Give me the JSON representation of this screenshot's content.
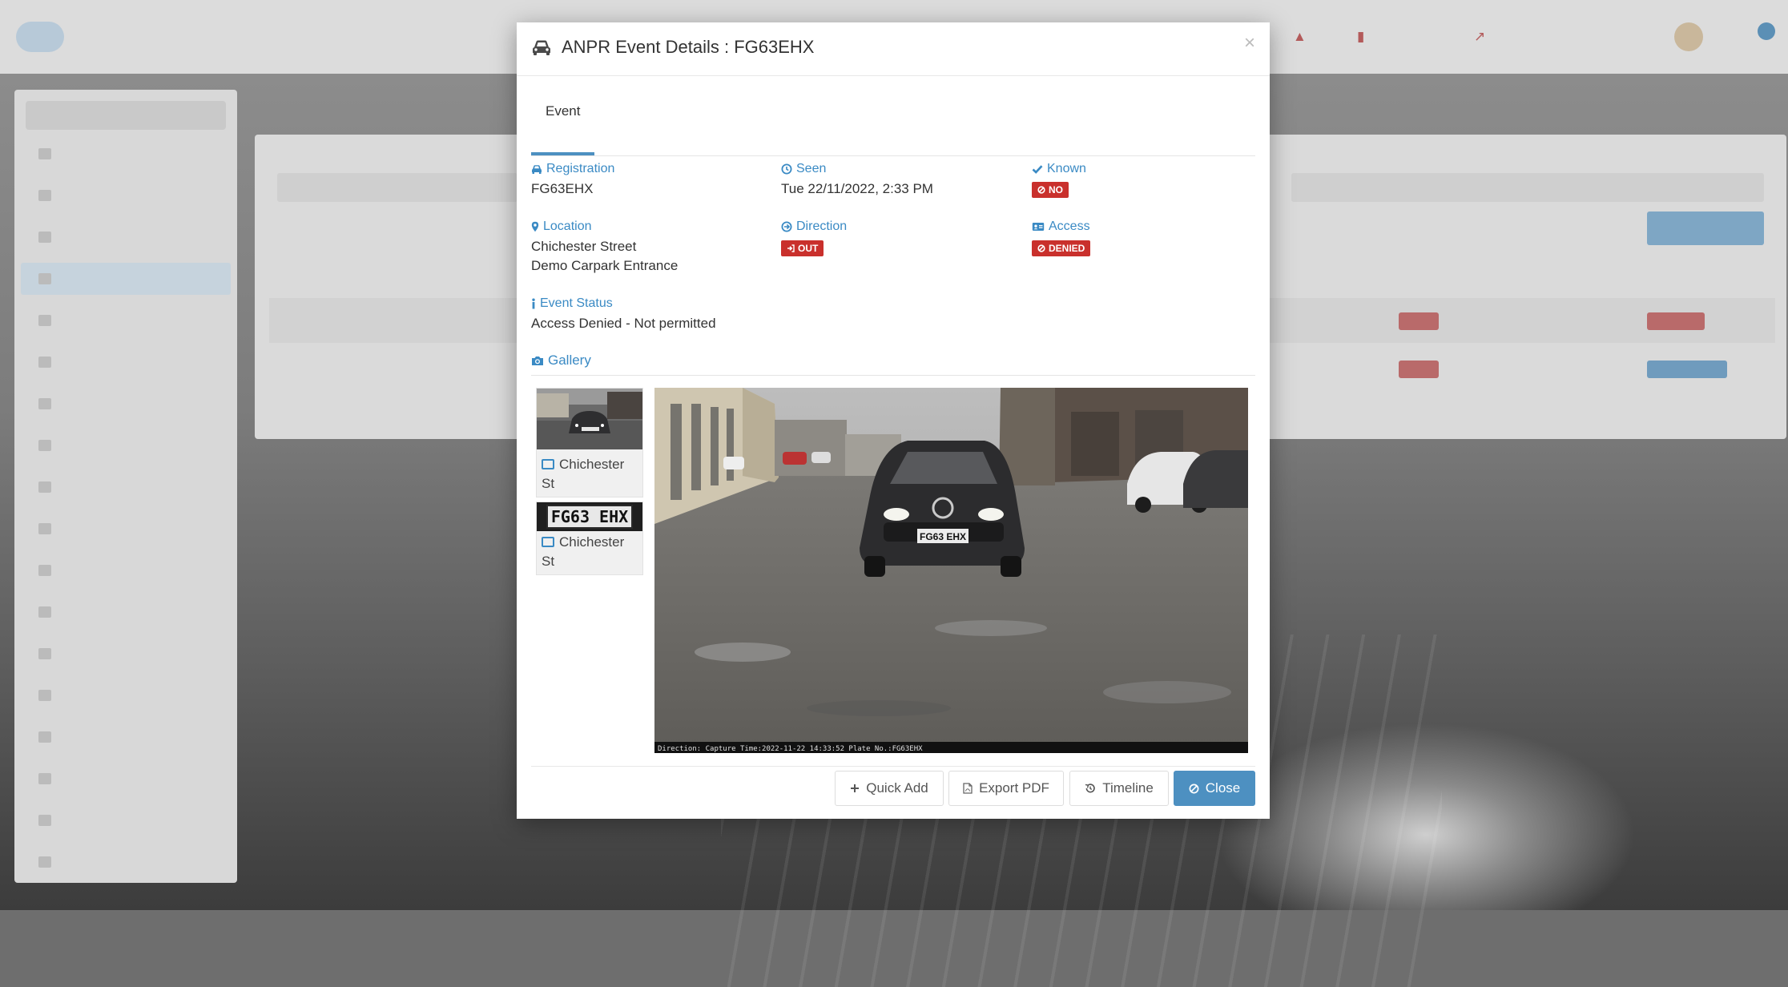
{
  "modal": {
    "title": "ANPR Event Details : FG63EHX",
    "tab": "Event",
    "fields": {
      "registration": {
        "label": "Registration",
        "value": "FG63EHX"
      },
      "seen": {
        "label": "Seen",
        "value": "Tue 22/11/2022, 2:33 PM"
      },
      "known": {
        "label": "Known",
        "badge": "NO"
      },
      "location": {
        "label": "Location",
        "line1": "Chichester Street",
        "line2": "Demo Carpark Entrance"
      },
      "direction": {
        "label": "Direction",
        "badge": "OUT"
      },
      "access": {
        "label": "Access",
        "badge": "DENIED"
      },
      "event_status": {
        "label": "Event Status",
        "value": "Access Denied - Not permitted"
      }
    },
    "gallery": {
      "label": "Gallery",
      "thumbs": [
        {
          "caption_line1": "Chichester",
          "caption_line2": "St"
        },
        {
          "caption_line1": "Chichester",
          "caption_line2": "St",
          "plate_text": "FG63 EHX"
        }
      ],
      "photo_plate": "FG63 EHX",
      "photo_caption": "Direction: Capture Time:2022-11-22  14:33:52 Plate No.:FG63EHX"
    },
    "buttons": {
      "quick_add": "Quick Add",
      "export_pdf": "Export PDF",
      "timeline": "Timeline",
      "close": "Close"
    },
    "colors": {
      "accent": "#3a8ac4",
      "primary_button": "#4d90c1",
      "danger": "#c9302c"
    }
  }
}
